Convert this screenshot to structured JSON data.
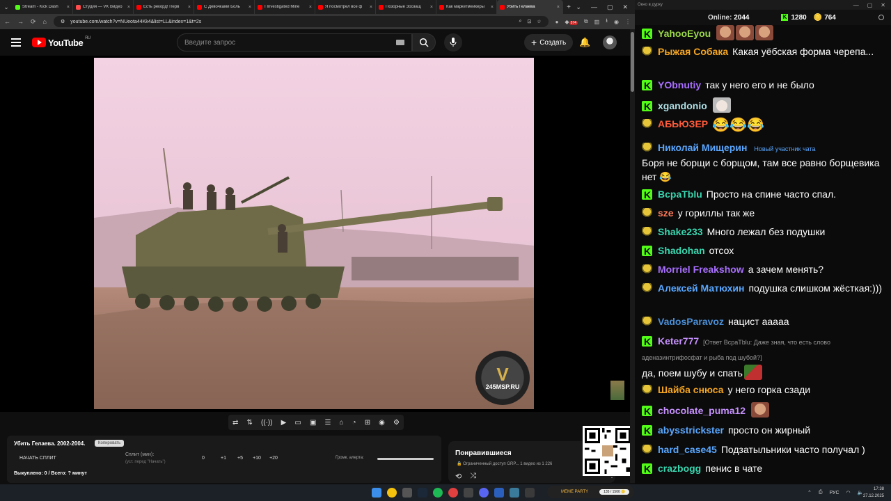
{
  "browser": {
    "tabs": [
      {
        "title": "Stream - Kick Dash",
        "color": "#53fc18"
      },
      {
        "title": "Студия — VK Видео",
        "color": "#ff4c4c"
      },
      {
        "title": "Есть рекорд! Перв",
        "color": "#ff0000"
      },
      {
        "title": "С Девочками Боль",
        "color": "#ff0000"
      },
      {
        "title": "I Investigated Mine",
        "color": "#ff0000"
      },
      {
        "title": "Я посмотрел все ф",
        "color": "#ff0000"
      },
      {
        "title": "Позорные Зоозащ",
        "color": "#ff0000"
      },
      {
        "title": "Как маркетмейкеры",
        "color": "#ff0000"
      },
      {
        "title": "Убить Гелаева",
        "color": "#ff0000",
        "active": true
      }
    ],
    "url": "youtube.com/watch?v=NUeota44Kk4&list=LL&index=1&t=2s",
    "ext_badge": "574"
  },
  "youtube": {
    "logo_text": "YouTube",
    "region": "RU",
    "search_placeholder": "Введите запрос",
    "create_label": "Создать"
  },
  "video": {
    "watermark_text": "245MSP.RU",
    "watermark_letter": "V"
  },
  "controls": [
    "⇄",
    "⇅",
    "((·))",
    "▶",
    "▭",
    "▣",
    "☰",
    "⌂",
    "◔",
    "⊞",
    "◉",
    "⚙"
  ],
  "alert_panel": {
    "title": "Убить Гелаева. 2002-2004.",
    "copy_label": "Копировать",
    "start_label": "НАЧАТЬ СПЛИТ",
    "split_label": "Сплит (мин):",
    "split_sub": "(уст. перед \"Начать\")",
    "split_values": [
      "0",
      "+1",
      "+5",
      "+10",
      "+20"
    ],
    "volume_label": "Громк. алерта:",
    "bought_label": "Выкуплено: 0 / Всего: ? минут"
  },
  "playlist": {
    "title": "Понравившиеся",
    "subtitle": "🔒 Ограниченный доступ GRP...  1 видео из 1 226"
  },
  "chat_window": {
    "title": "Окно в дурку",
    "online_label": "Online:",
    "online_count": "2044",
    "kick_count": "1280",
    "coin_count": "764"
  },
  "chat": [
    {
      "user": "YahooEyou",
      "color": "#9bd84a",
      "badge": "kick",
      "text": "",
      "emotes": [
        "face",
        "face",
        "face"
      ]
    },
    {
      "user": "Рыжая Собака",
      "color": "#f5a623",
      "badge": "sub",
      "text": "Какая уёбская форма черепа..."
    },
    {
      "user": "YObnutiy",
      "color": "#a970ff",
      "badge": "kick",
      "text": "так у него его и не было"
    },
    {
      "user": "xgandonio",
      "color": "#b0e0e6",
      "badge": "kick",
      "text": "",
      "emotes": [
        "cat"
      ]
    },
    {
      "user": "АБЬЮЗЕР",
      "color": "#ff5b3a",
      "badge": "sub",
      "text": "",
      "emotes": [
        "laugh",
        "laugh",
        "laugh"
      ]
    },
    {
      "user": "Николай Мищерин",
      "color": "#5aa7ff",
      "badge": "sub",
      "new_label": "Новый участник чата",
      "text": "Боря не борщи с борщом, там все равно борщевика нет 😂"
    },
    {
      "user": "BcpaTblu",
      "color": "#3ad7b0",
      "badge": "kick",
      "text": "Просто на спине часто спал."
    },
    {
      "user": "sze",
      "color": "#ff7b5a",
      "badge": "sub",
      "text": "у гориллы так же"
    },
    {
      "user": "Shake233",
      "color": "#3ad7b0",
      "badge": "sub",
      "text": "Много лежал без подушки"
    },
    {
      "user": "Shadohan",
      "color": "#3ad7b0",
      "badge": "kick",
      "text": "отсох"
    },
    {
      "user": "Morriel Freakshow",
      "color": "#a970ff",
      "badge": "sub",
      "text": "а зачем менять?"
    },
    {
      "user": "Алексей Матюхин",
      "color": "#5aa7ff",
      "badge": "sub",
      "text": "подушка слишком жёсткая:)))"
    },
    {
      "user": "VadosParavoz",
      "color": "#4a8fd8",
      "badge": "sub",
      "text": "нацист ааааа"
    },
    {
      "user": "Keter777",
      "color": "#c792ff",
      "badge": "kick",
      "reply": "[Ответ BcpaTblu: Даже зная, что есть слово аденазинтрифосфат и рыба под шубой?]",
      "text": "да, поем шубу и спать"
    },
    {
      "user": "Шайба снюса",
      "color": "#f5a623",
      "badge": "sub",
      "text": "у него горка сзади"
    },
    {
      "user": "chocolate_puma12",
      "color": "#c792ff",
      "badge": "kick",
      "text": "",
      "emotes": [
        "face"
      ]
    },
    {
      "user": "abysstrickster",
      "color": "#5aa7ff",
      "badge": "kick",
      "text": "просто он жирный"
    },
    {
      "user": "hard_case45",
      "color": "#5aa7ff",
      "badge": "sub",
      "text": "Подзатыльники часто получал )"
    },
    {
      "user": "crazbogg",
      "color": "#3ad7b0",
      "badge": "kick",
      "text": "пенис в чате"
    }
  ],
  "taskbar": {
    "meme_party": "MEME PARTY",
    "meme_progress": "135 / 1500 🪙",
    "lang": "РУС",
    "time": "17:38",
    "date": "27.12.2025"
  }
}
